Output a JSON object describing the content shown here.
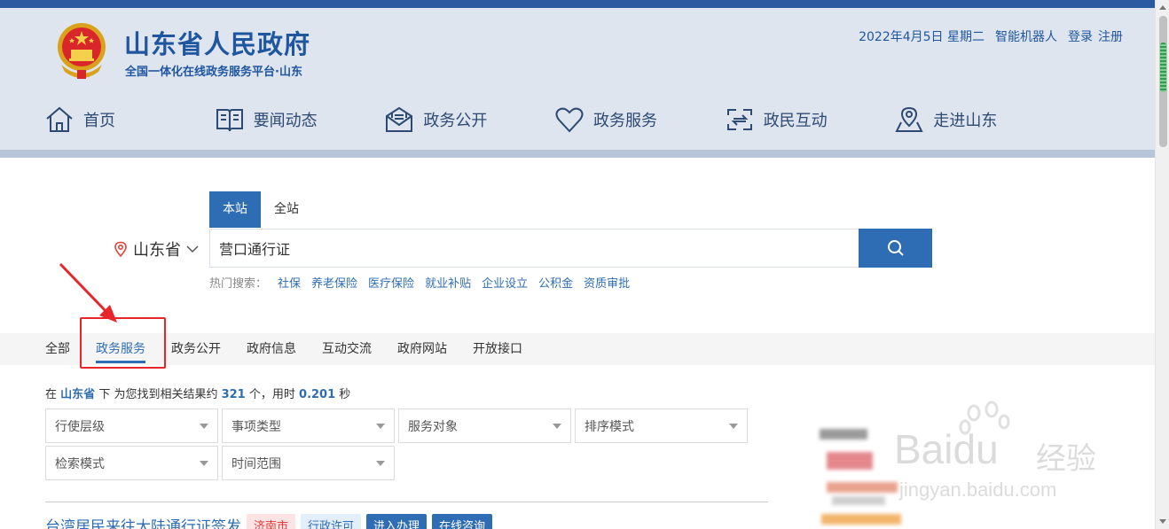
{
  "header": {
    "title": "山东省人民政府",
    "subtitle": "全国一体化在线政务服务平台·山东",
    "date": "2022年4月5日",
    "weekday": "星期二",
    "robot": "智能机器人",
    "login": "登录",
    "register": "注册"
  },
  "nav": [
    {
      "label": "首页",
      "icon": "home-icon"
    },
    {
      "label": "要闻动态",
      "icon": "book-icon"
    },
    {
      "label": "政务公开",
      "icon": "mail-icon"
    },
    {
      "label": "政务服务",
      "icon": "heart-icon"
    },
    {
      "label": "政民互动",
      "icon": "exchange-icon"
    },
    {
      "label": "走进山东",
      "icon": "map-pin-icon"
    }
  ],
  "search": {
    "tabs": [
      "本站",
      "全站"
    ],
    "active_tab": "本站",
    "region": "山东省",
    "query": "营口通行证",
    "hot_label": "热门搜索：",
    "hot": [
      "社保",
      "养老保险",
      "医疗保险",
      "就业补贴",
      "企业设立",
      "公积金",
      "资质审批"
    ]
  },
  "categories": [
    "全部",
    "政务服务",
    "政务公开",
    "政府信息",
    "互动交流",
    "政府网站",
    "开放接口"
  ],
  "active_category": "政务服务",
  "result_info": {
    "prefix": "在",
    "region": "山东省",
    "mid": "下 为您找到相关结果约",
    "count": "321",
    "unit": "个，用时",
    "time": "0.201",
    "suffix": "秒"
  },
  "filters": [
    "行使层级",
    "事项类型",
    "服务对象",
    "排序模式",
    "检索模式",
    "时间范围"
  ],
  "first_result": {
    "title": "台湾居民来往大陆通行证签发",
    "tag_city": "济南市",
    "tag_type": "行政许可",
    "btn_handle": "进入办理",
    "btn_consult": "在线咨询"
  },
  "watermark": {
    "brand": "Bai",
    "brand2": "du",
    "cn": "经验",
    "url": "jingyan.baidu.com"
  },
  "colors": {
    "brand_blue": "#1f56a0",
    "accent_blue": "#2e6db4",
    "annotation_red": "#e8262a"
  }
}
